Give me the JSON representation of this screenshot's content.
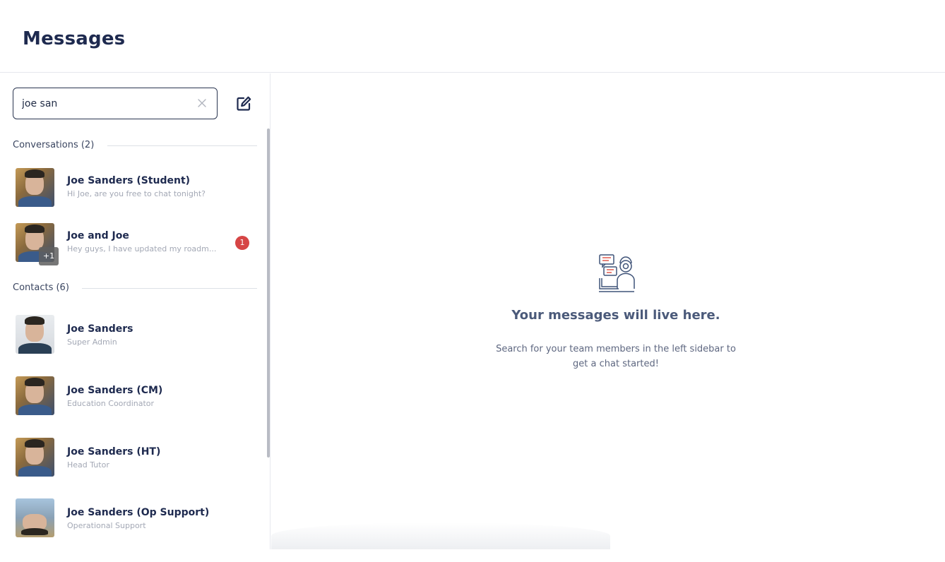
{
  "header": {
    "title": "Messages"
  },
  "search": {
    "value": "joe san",
    "placeholder": ""
  },
  "sections": {
    "conversations_label": "Conversations (2)",
    "contacts_label": "Contacts (6)"
  },
  "conversations": [
    {
      "name": "Joe Sanders (Student)",
      "preview": "Hi Joe, are you free to chat tonight?",
      "unread": ""
    },
    {
      "name": "Joe and Joe",
      "preview": "Hey guys, I have updated my roadm...",
      "unread": "1",
      "extra_members": "+1"
    }
  ],
  "contacts": [
    {
      "name": "Joe Sanders",
      "role": "Super Admin"
    },
    {
      "name": "Joe Sanders (CM)",
      "role": "Education Coordinator"
    },
    {
      "name": "Joe Sanders (HT)",
      "role": "Head Tutor"
    },
    {
      "name": "Joe Sanders (Op Support)",
      "role": "Operational Support"
    }
  ],
  "empty_state": {
    "title": "Your messages will live here.",
    "subtitle": "Search for your team members in the left sidebar to get a chat started!",
    "icon": "chat-support-icon"
  },
  "colors": {
    "title": "#1e2a4f",
    "badge": "#d64545",
    "accent_icon": "#e05a4f",
    "icon_stroke": "#3f5378"
  }
}
